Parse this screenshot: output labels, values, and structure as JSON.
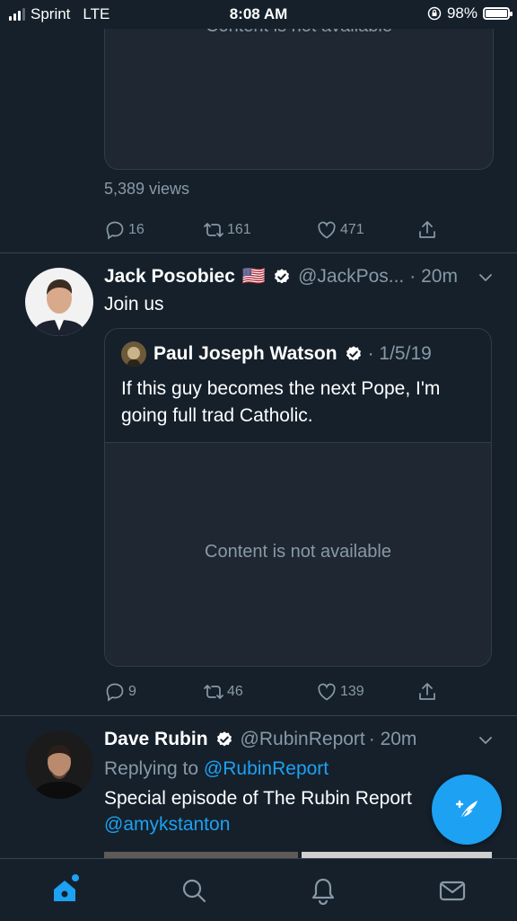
{
  "status_bar": {
    "carrier": "Sprint",
    "network": "LTE",
    "time": "8:08 AM",
    "battery": "98%",
    "battery_level": 0.98
  },
  "tweet_top": {
    "media_text": "Content is not available",
    "views": "5,389 views",
    "replies": "16",
    "retweets": "161",
    "likes": "471"
  },
  "tweet_jack": {
    "name": "Jack Posobiec",
    "flag": "🇺🇸",
    "handle": "@JackPos...",
    "time": "· 20m",
    "text": "Join us",
    "quote": {
      "name": "Paul Joseph Watson",
      "date": "· 1/5/19",
      "text": "If this guy becomes the next Pope, I'm going full trad Catholic.",
      "media_text": "Content is not available"
    },
    "replies": "9",
    "retweets": "46",
    "likes": "139"
  },
  "tweet_dave": {
    "name": "Dave Rubin",
    "handle": "@RubinReport",
    "time": "· 20m",
    "replying_label": "Replying to",
    "replying_to": "@RubinReport",
    "text": "Special episode of The Rubin Report",
    "mention": "@amykstanton"
  },
  "tabs": [
    "home-icon",
    "search-icon",
    "bell-icon",
    "mail-icon"
  ],
  "colors": {
    "background": "#15202b",
    "accent": "#1da1f2",
    "muted": "#8899a6"
  }
}
